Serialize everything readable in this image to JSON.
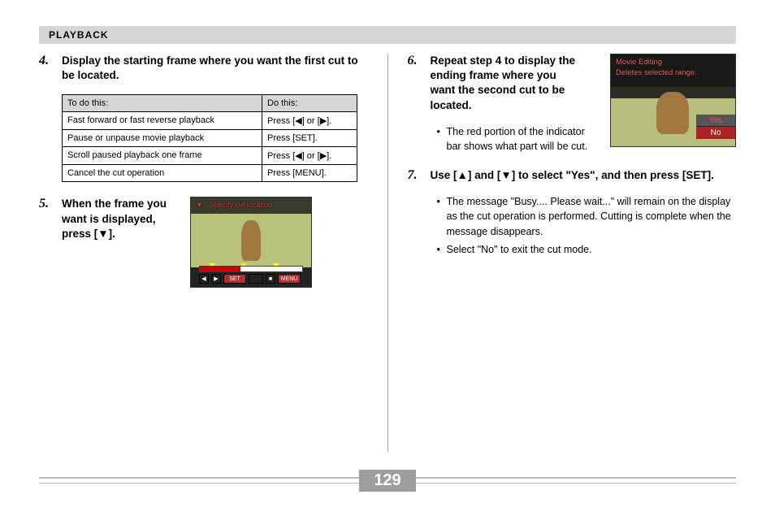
{
  "header": {
    "title": "PLAYBACK"
  },
  "steps": {
    "s4": {
      "num": "4.",
      "text": "Display the starting frame where you want the first cut to be located."
    },
    "s5": {
      "num": "5.",
      "text": "When the frame you want is displayed, press [▼]."
    },
    "s6": {
      "num": "6.",
      "text": "Repeat step 4 to display the ending frame where you want the second cut to be located."
    },
    "s7": {
      "num": "7.",
      "text": "Use [▲] and [▼] to select \"Yes\", and then press [SET]."
    }
  },
  "table": {
    "head1": "To do this:",
    "head2": "Do this:",
    "rows": [
      {
        "a": "Fast forward or fast reverse playback",
        "b": "Press [◀] or [▶]."
      },
      {
        "a": "Pause or unpause movie playback",
        "b": "Press [SET]."
      },
      {
        "a": "Scroll paused playback one frame",
        "b": "Press [◀] or [▶]."
      },
      {
        "a": "Cancel the cut operation",
        "b": "Press [MENU]."
      }
    ]
  },
  "screenshot_a": {
    "red_text": "▼ : Specify cut location",
    "btn_set": "SET",
    "btn_menu": "MENU"
  },
  "screenshot_b": {
    "title": "Movie Editing",
    "subtitle": "Deletes selected range.",
    "yes": "Yes",
    "no": "No"
  },
  "bullets_6": [
    "The red portion of the indicator bar shows what part will be cut."
  ],
  "bullets_7": [
    "The message \"Busy.... Please wait...\" will remain on the display as the cut operation is performed. Cutting is complete when the message disappears.",
    "Select \"No\" to exit the cut mode."
  ],
  "page_number": "129"
}
